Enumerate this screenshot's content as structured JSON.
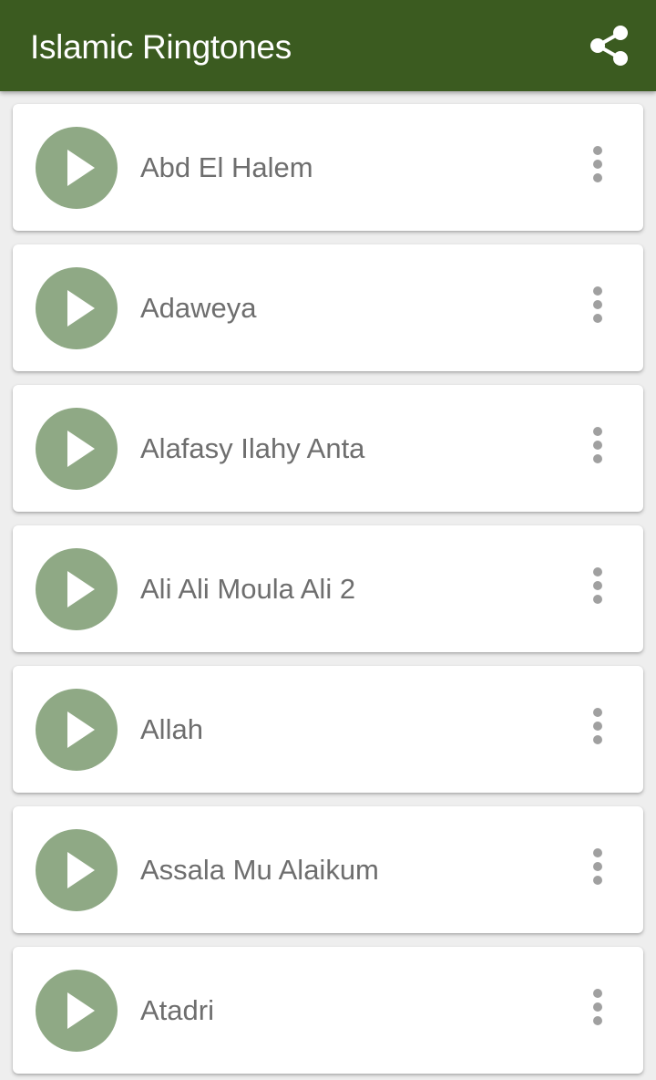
{
  "appbar": {
    "title": "Islamic Ringtones",
    "share_icon": "share-icon",
    "color": "#3b5b20"
  },
  "ringtones": [
    {
      "name": "Abd El Halem"
    },
    {
      "name": "Adaweya"
    },
    {
      "name": "Alafasy Ilahy Anta"
    },
    {
      "name": "Ali Ali Moula Ali 2"
    },
    {
      "name": "Allah"
    },
    {
      "name": "Assala Mu Alaikum"
    },
    {
      "name": "Atadri"
    }
  ],
  "icons": {
    "play": "play-icon",
    "more": "more-vert-icon"
  },
  "colors": {
    "play_button": "#8fa985",
    "text": "#6e6e6e",
    "background": "#eeeeee"
  }
}
